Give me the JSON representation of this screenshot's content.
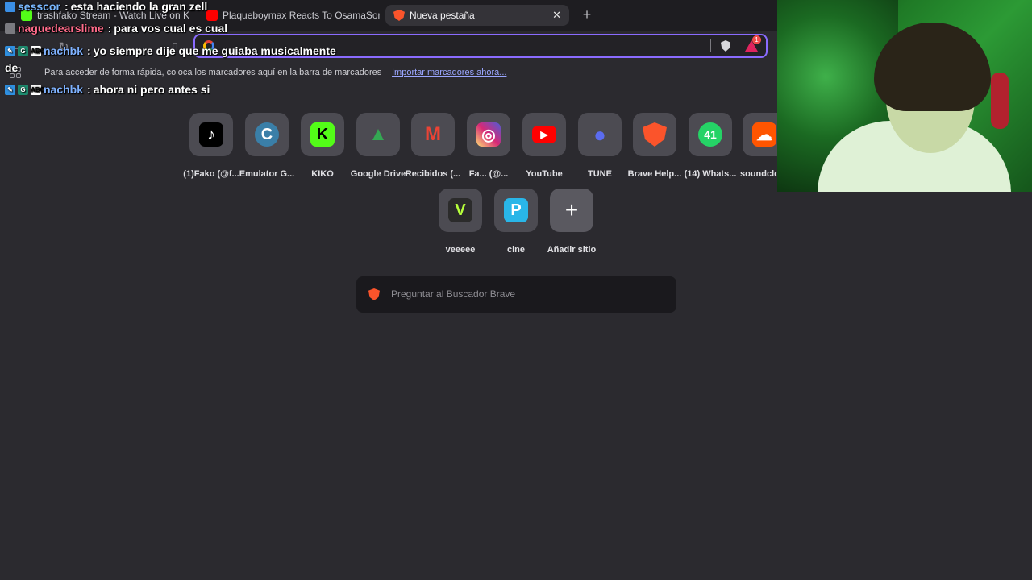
{
  "browser": {
    "tabs": [
      {
        "title": "trashfako Stream - Watch Live on Kick",
        "favicon_color": "#53fc18",
        "active": false
      },
      {
        "title": "Plaqueboymax Reacts To OsamaSon",
        "favicon_color": "#ff0000",
        "active": false
      },
      {
        "title": "Nueva pestaña",
        "favicon_color": "#fb542b",
        "active": true
      }
    ],
    "close_glyph": "✕",
    "new_tab_glyph": "+",
    "omnibox": {
      "value": ""
    },
    "rewards_badge": "1",
    "bookmarks_bar": {
      "text": "Para acceder de forma rápida, coloca los marcadores aquí en la barra de marcadores",
      "import_link": "Importar marcadores ahora..."
    }
  },
  "chat": [
    {
      "user": "sesscor",
      "color": "#7ab8ff",
      "message": "esta haciendo la gran zell",
      "badges": [
        "#3a8ee6"
      ]
    },
    {
      "user": "naguedearslime",
      "color": "#ff6b8a",
      "message": "para vos cual es cual",
      "badges": [
        "#7a7a80"
      ]
    },
    {
      "user": "nachbk",
      "color": "#7fb2ff",
      "message": "yo siempre dije que me guiaba musicalmente",
      "badges": [
        "#2f8fe0",
        "#1e8a6e",
        "#ffffff"
      ]
    },
    {
      "user": "de",
      "color": "#ffffff",
      "message": "",
      "badges": []
    },
    {
      "user": "nachbk",
      "color": "#7fb2ff",
      "message": "ahora ni pero antes si",
      "badges": [
        "#2f8fe0",
        "#1e8a6e",
        "#ffffff"
      ]
    }
  ],
  "chat_badge_text": "ABC",
  "shortcuts": [
    {
      "label": "(1)Fako (@f...",
      "icon": "tiktok-icon",
      "glyph": "♪",
      "bg": "#000000",
      "fg": "#ffffff"
    },
    {
      "label": "Emulator G...",
      "icon": "emulator-icon",
      "glyph": "C",
      "bg": "#3a7fa8",
      "fg": "#ffffff"
    },
    {
      "label": "KIKO",
      "icon": "kick-icon",
      "glyph": "K",
      "bg": "#53fc18",
      "fg": "#000000"
    },
    {
      "label": "Google Drive",
      "icon": "google-drive-icon",
      "glyph": "▲",
      "bg": "#4c4b52",
      "fg": "#34a853"
    },
    {
      "label": "Recibidos (...",
      "icon": "gmail-icon",
      "glyph": "M",
      "bg": "#4c4b52",
      "fg": "#ea4335"
    },
    {
      "label": "Fa...  (@...",
      "icon": "instagram-icon",
      "glyph": "◎",
      "bg": "#d62976",
      "fg": "#ffffff"
    },
    {
      "label": "YouTube",
      "icon": "youtube-icon",
      "glyph": "▶",
      "bg": "#ff0000",
      "fg": "#ffffff"
    },
    {
      "label": "TUNE",
      "icon": "tune-icon",
      "glyph": "●",
      "bg": "#4c4b52",
      "fg": "#5b6cf0"
    },
    {
      "label": "Brave Help...",
      "icon": "brave-icon",
      "glyph": "◆",
      "bg": "#4c4b52",
      "fg": "#fb542b"
    },
    {
      "label": "(14) Whats...",
      "icon": "whatsapp-icon",
      "glyph": "41",
      "bg": "#25d366",
      "fg": "#ffffff"
    },
    {
      "label": "soundclo",
      "icon": "soundcloud-icon",
      "glyph": "☁",
      "bg": "#ff5500",
      "fg": "#ffffff"
    }
  ],
  "shortcuts_row2": [
    {
      "label": "veeeee",
      "icon": "v-icon",
      "glyph": "V",
      "bg": "#2b2b2b",
      "fg": "#b6ff3b"
    },
    {
      "label": "cine",
      "icon": "p-icon",
      "glyph": "P",
      "bg": "#29b6e8",
      "fg": "#ffffff"
    },
    {
      "label": "Añadir sitio",
      "icon": "plus-icon",
      "glyph": "+",
      "bg": "#5a5960",
      "fg": "#ffffff"
    }
  ],
  "search": {
    "placeholder": "Preguntar al Buscador Brave"
  }
}
